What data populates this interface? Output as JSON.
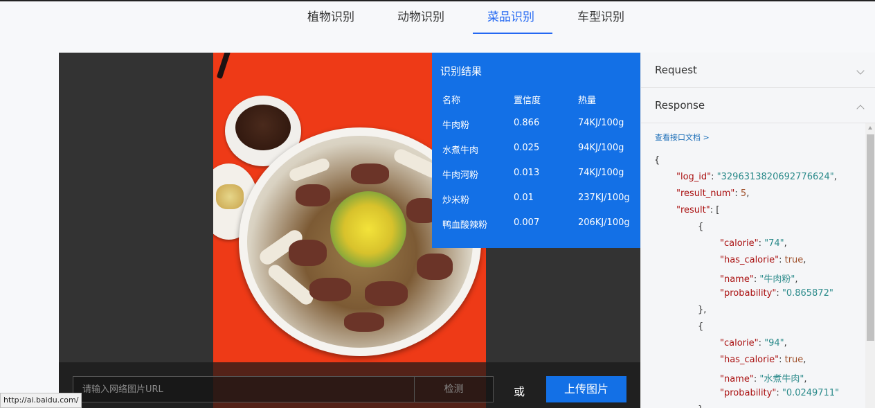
{
  "tabs": [
    {
      "label": "植物识别"
    },
    {
      "label": "动物识别"
    },
    {
      "label": "菜品识别"
    },
    {
      "label": "车型识别"
    }
  ],
  "result": {
    "title": "识别结果",
    "headers": [
      "名称",
      "置信度",
      "热量"
    ],
    "rows": [
      [
        "牛肉粉",
        "0.866",
        "74KJ/100g"
      ],
      [
        "水煮牛肉",
        "0.025",
        "94KJ/100g"
      ],
      [
        "牛肉河粉",
        "0.013",
        "74KJ/100g"
      ],
      [
        "炒米粉",
        "0.01",
        "237KJ/100g"
      ],
      [
        "鸭血酸辣粉",
        "0.007",
        "206KJ/100g"
      ]
    ]
  },
  "bar": {
    "url_placeholder": "请输入网络图片URL",
    "detect_label": "检测",
    "or_label": "或",
    "upload_label": "上传图片"
  },
  "panel": {
    "request_label": "Request",
    "response_label": "Response",
    "doc_link": "查看接口文档 >",
    "json": {
      "log_id_key": "\"log_id\"",
      "log_id_val": "\"3296313820692776624\"",
      "result_num_key": "\"result_num\"",
      "result_num_val": "5",
      "result_key": "\"result\"",
      "calorie_key": "\"calorie\"",
      "has_calorie_key": "\"has_calorie\"",
      "name_key": "\"name\"",
      "probability_key": "\"probability\"",
      "true_val": "true",
      "item1": {
        "calorie": "\"74\"",
        "name": "\"牛肉粉\"",
        "probability": "\"0.865872\""
      },
      "item2": {
        "calorie": "\"94\"",
        "name": "\"水煮牛肉\"",
        "probability": "\"0.0249711\""
      }
    }
  },
  "status_url": "http://ai.baidu.com/",
  "accent_color": "#2468f2",
  "result_bg_color": "#1370e6"
}
